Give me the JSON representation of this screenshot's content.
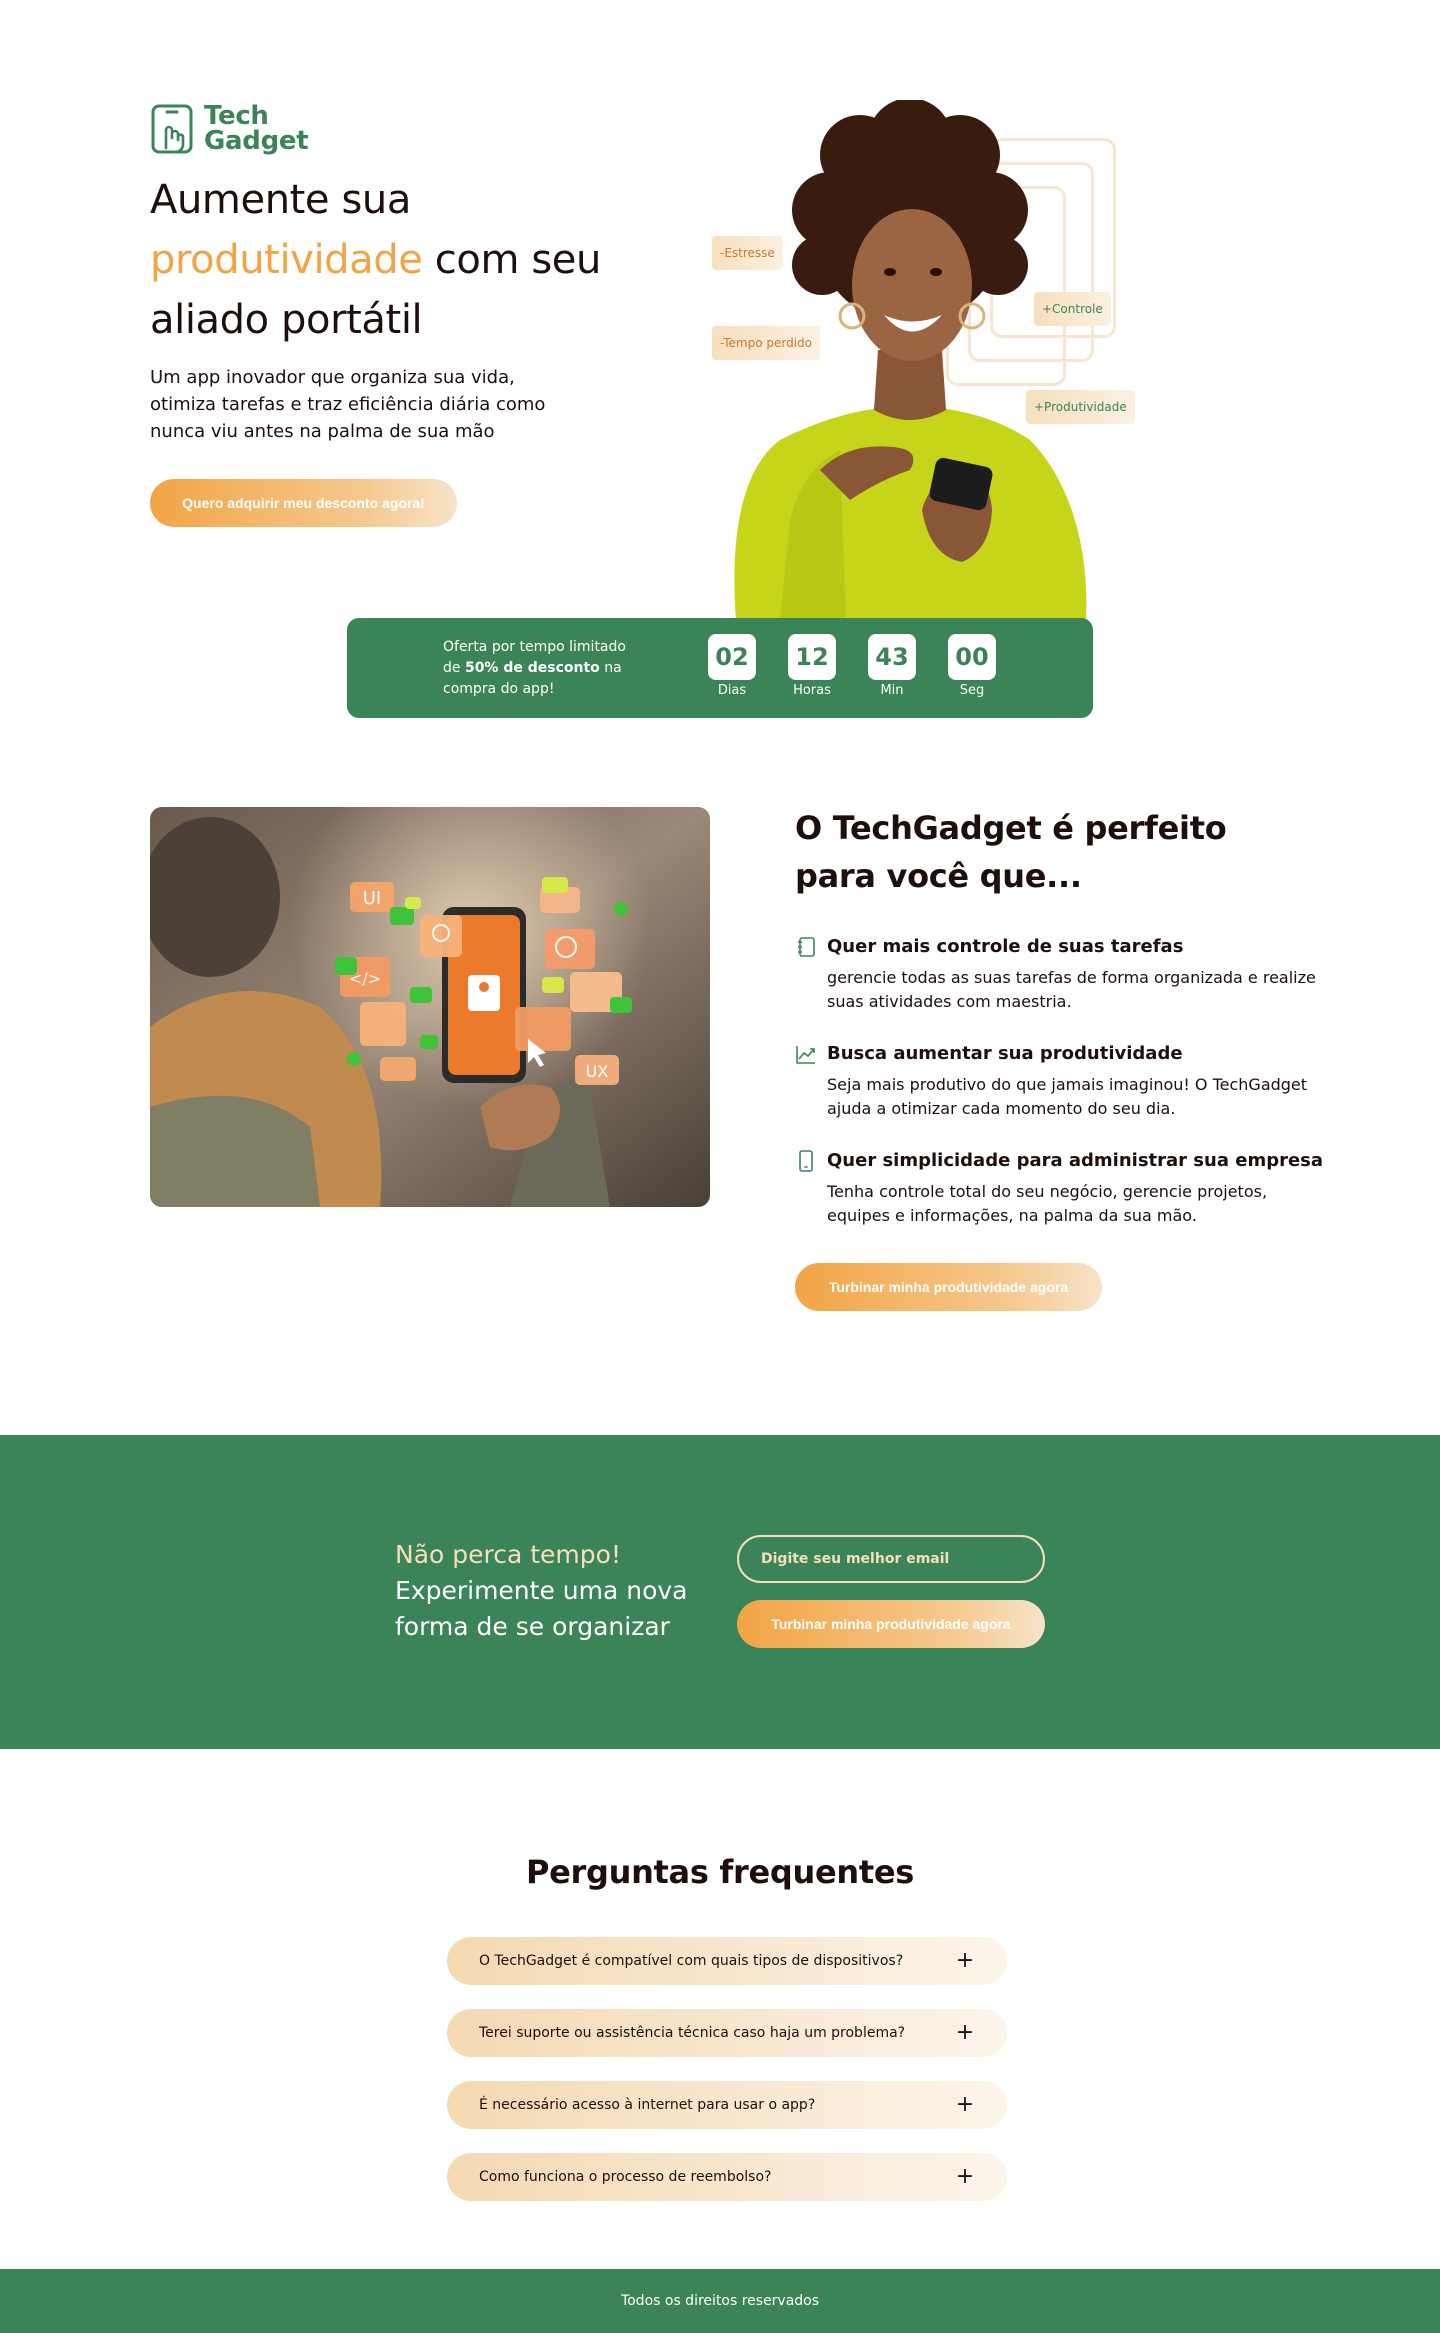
{
  "brand": {
    "name_line1": "Tech",
    "name_line2": "Gadget"
  },
  "hero": {
    "title_part1": "Aumente sua",
    "title_accent": "produtividade",
    "title_part2": "com seu aliado portátil",
    "subtitle": "Um app inovador que organiza sua vida, otimiza tarefas e traz eficiência diária como nunca viu antes na palma de sua mão",
    "cta_label": "Quero adquirir meu desconto agora!",
    "tags": {
      "stress": "-Estresse",
      "control": "+Controle",
      "lost_time": "-Tempo perdido",
      "productivity": "+Produtividade"
    }
  },
  "countdown": {
    "text_before": "Oferta por tempo limitado de",
    "text_bold": "50% de desconto",
    "text_after": "na compra do app!",
    "units": [
      {
        "value": "02",
        "label": "Dias"
      },
      {
        "value": "12",
        "label": "Horas"
      },
      {
        "value": "43",
        "label": "Min"
      },
      {
        "value": "00",
        "label": "Seg"
      }
    ]
  },
  "perfect": {
    "title": "O TechGadget é perfeito para você que...",
    "image_labels": {
      "ui": "UI",
      "ux": "UX"
    },
    "features": [
      {
        "title": "Quer mais controle de suas tarefas",
        "desc": "gerencie todas as suas tarefas de forma organizada e realize suas atividades com maestria.",
        "icon": "notebook-icon"
      },
      {
        "title": "Busca aumentar sua produtividade",
        "desc": "Seja mais produtivo do que jamais imaginou! O TechGadget ajuda a otimizar cada momento do seu dia.",
        "icon": "trend-up-icon"
      },
      {
        "title": "Quer simplicidade para administrar sua empresa",
        "desc": "Tenha controle total do seu negócio, gerencie projetos, equipes e informações, na palma da sua mão.",
        "icon": "smartphone-icon"
      }
    ],
    "cta_label": "Turbinar minha produtividade agora"
  },
  "newsletter": {
    "title_accent": "Não perca tempo!",
    "title_rest": "Experimente uma nova forma de se organizar",
    "email_placeholder": "Digite seu melhor email",
    "cta_label": "Turbinar minha produtividade agora"
  },
  "faq": {
    "title": "Perguntas frequentes",
    "items": [
      {
        "question": "O TechGadget é compatível com quais tipos de dispositivos?"
      },
      {
        "question": "Terei suporte ou assistência técnica caso haja um problema?"
      },
      {
        "question": "É necessário acesso à internet para usar o app?"
      },
      {
        "question": "Como funciona o processo de reembolso?"
      }
    ],
    "expand_symbol": "+"
  },
  "footer": {
    "text": "Todos os direitos reservados"
  },
  "colors": {
    "primary_green": "#3b8457",
    "accent_orange": "#f2a444",
    "cream": "#f6dfbd",
    "text_dark": "#1f0e0e"
  }
}
